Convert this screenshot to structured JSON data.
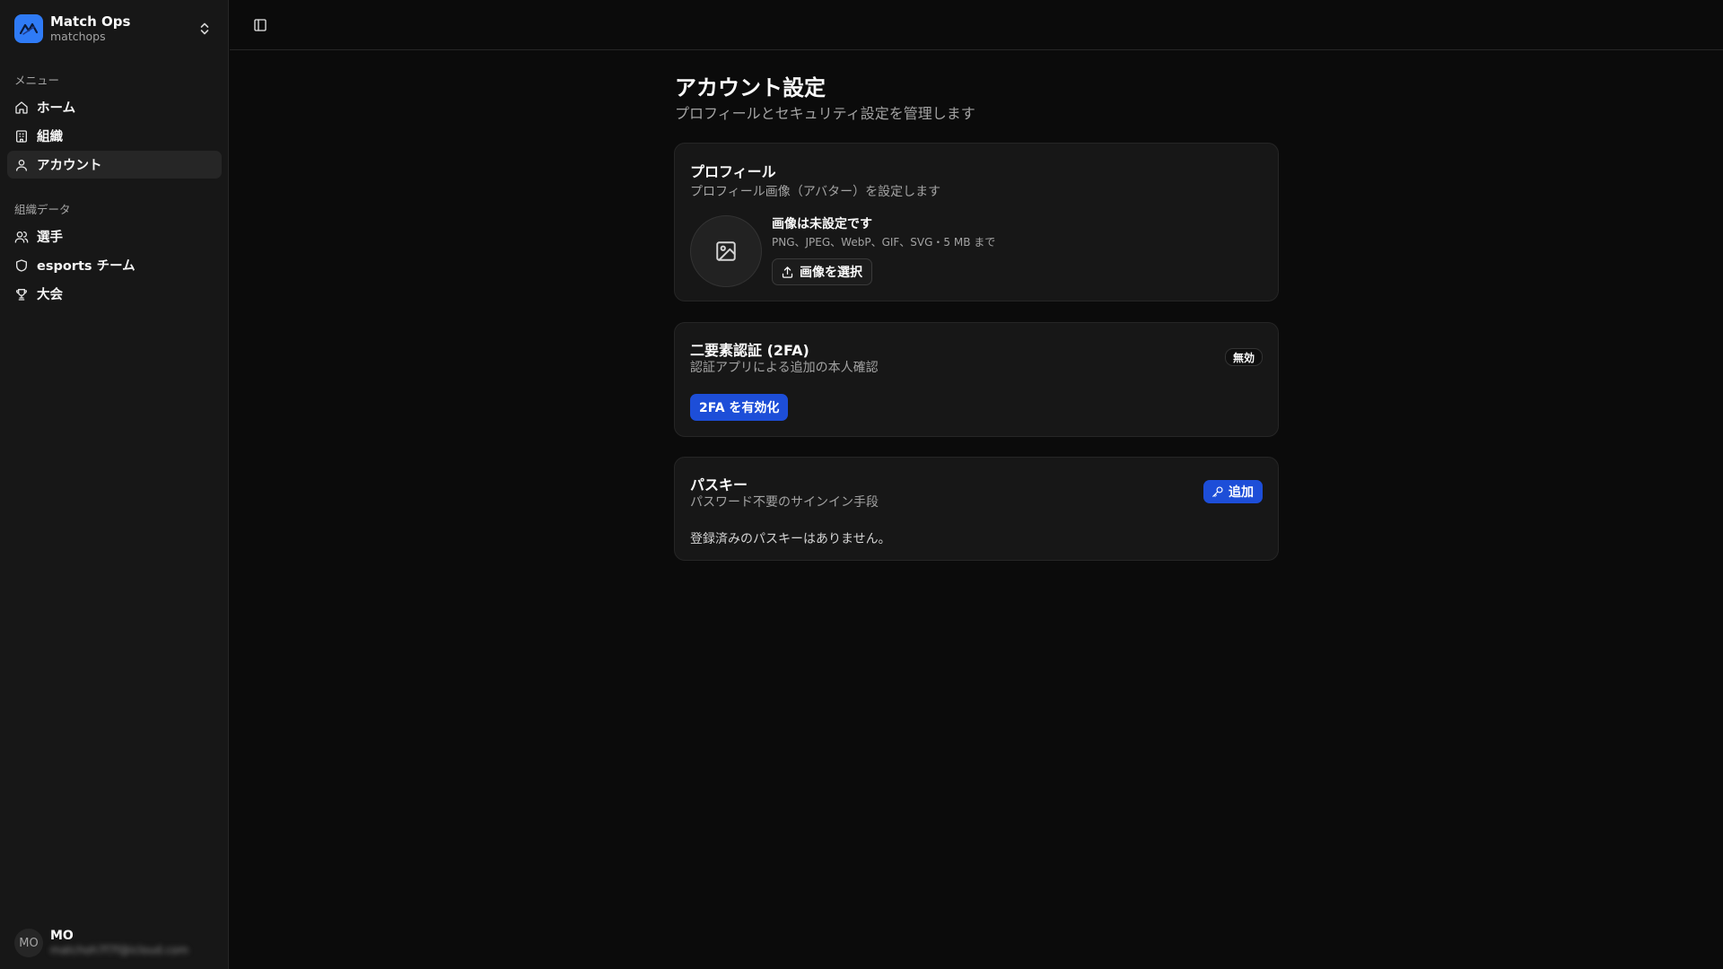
{
  "sidebar": {
    "brand": {
      "name": "Match Ops",
      "slug": "matchops",
      "logo_icon": "match-ops-logo"
    },
    "groups": [
      {
        "label": "メニュー",
        "items": [
          {
            "label": "ホーム",
            "icon": "home-icon"
          },
          {
            "label": "組織",
            "icon": "building-icon"
          },
          {
            "label": "アカウント",
            "icon": "user-icon",
            "active": true
          }
        ]
      },
      {
        "label": "組織データ",
        "items": [
          {
            "label": "選手",
            "icon": "users-icon"
          },
          {
            "label": "esports チーム",
            "icon": "shield-icon"
          },
          {
            "label": "大会",
            "icon": "trophy-icon"
          }
        ]
      }
    ],
    "user": {
      "initials": "MO",
      "name": "MO",
      "email": "matchoh7f7f@icloud.com"
    }
  },
  "header": {
    "toggle_icon": "sidebar-toggle-icon"
  },
  "main": {
    "title": "アカウント設定",
    "subtitle": "プロフィールとセキュリティ設定を管理します",
    "profile": {
      "title": "プロフィール",
      "description": "プロフィール画像（アバター）を設定します",
      "image_status": "画像は未設定です",
      "image_hint": "PNG、JPEG、WebP、GIF、SVG・5 MB まで",
      "select_button": "画像を選択"
    },
    "twofa": {
      "title": "二要素認証 (2FA)",
      "description": "認証アプリによる追加の本人確認",
      "status_badge": "無効",
      "enable_button": "2FA を有効化"
    },
    "passkey": {
      "title": "パスキー",
      "description": "パスワード不要のサインイン手段",
      "add_button": "追加",
      "empty_text": "登録済みのパスキーはありません。"
    }
  },
  "colors": {
    "background": "#0b0b0b",
    "sidebar": "#171717",
    "card": "#171717",
    "border": "#262626",
    "accent": "#1d4ed8",
    "brand": "#2f7bf6"
  }
}
